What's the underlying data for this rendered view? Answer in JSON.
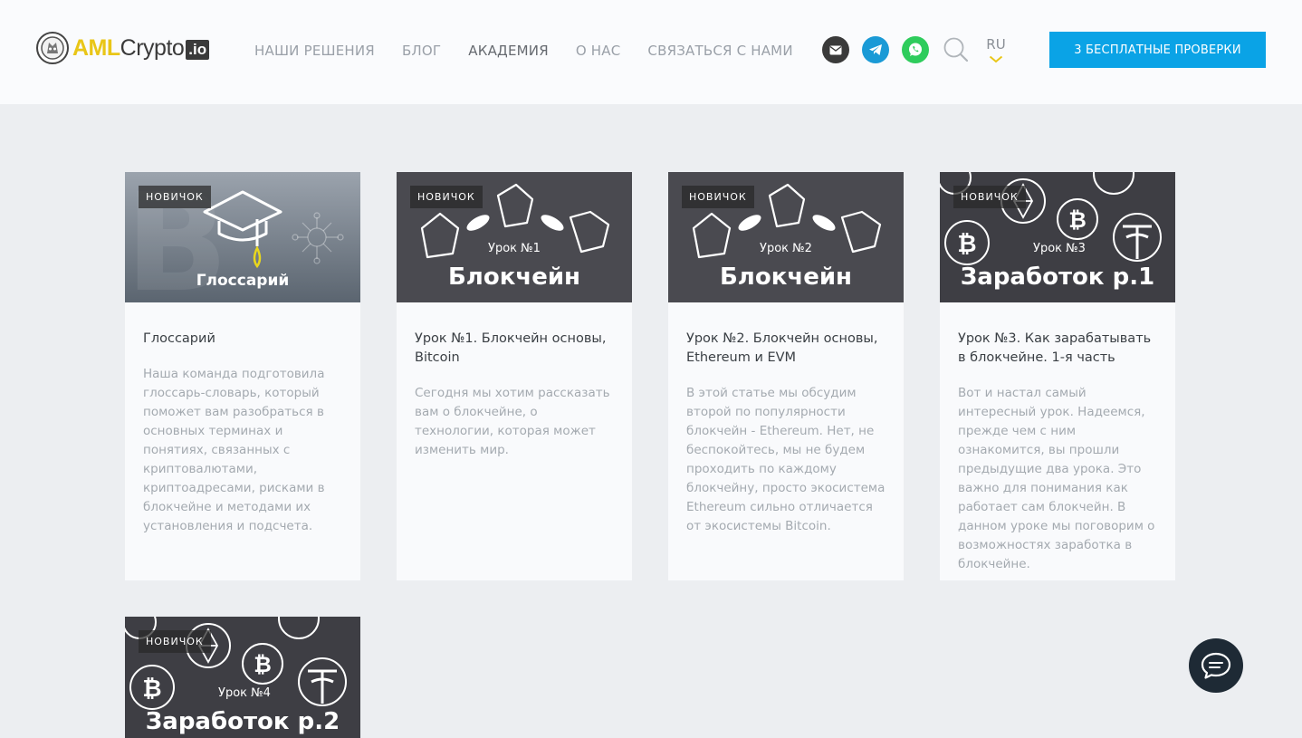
{
  "header": {
    "logo": {
      "brand_a": "AML",
      "brand_b": "Crypto",
      "brand_c": ".io"
    },
    "nav": [
      {
        "label": "НАШИ РЕШЕНИЯ"
      },
      {
        "label": "БЛОГ"
      },
      {
        "label": "АКАДЕМИЯ"
      },
      {
        "label": "О НАС"
      },
      {
        "label": "СВЯЗАТЬСЯ С НАМИ"
      }
    ],
    "social_icons": [
      "mail-icon",
      "telegram-icon",
      "whatsapp-icon"
    ],
    "language": "RU",
    "cta_label": "3 БЕСПЛАТНЫЕ ПРОВЕРКИ"
  },
  "cards": [
    {
      "badge": "НОВИЧОК",
      "image_text": "Глоссарий",
      "title": "Глоссарий",
      "description": "Наша команда подготовила глоссарь-словарь, который поможет вам разобраться в основных терминах и понятиях, связанных с криптовалютами, криптоадресами, рисками в блокчейне и методами их установления и подсчета."
    },
    {
      "badge": "НОВИЧОК",
      "image_subtitle": "Урок №1",
      "image_text": "Блокчейн",
      "title": "Урок №1. Блокчейн основы, Bitcoin",
      "description": "Сегодня мы хотим рассказать вам о блокчейне, о технологии, которая может изменить мир."
    },
    {
      "badge": "НОВИЧОК",
      "image_subtitle": "Урок №2",
      "image_text": "Блокчейн",
      "title": "Урок №2. Блокчейн основы, Ethereum и EVM",
      "description": "В этой статье мы обсудим второй по популярности блокчейн - Ethereum. Нет, не беспокойтесь, мы не будем проходить по каждому блокчейну, просто экосистема Ethereum сильно отличается от экосистемы Bitcoin."
    },
    {
      "badge": "НОВИЧОК",
      "image_subtitle": "Урок №3",
      "image_text": "Заработок р.1",
      "title": "Урок №3. Как зарабатывать в блокчейне. 1-я часть",
      "description": "Вот и настал самый интересный урок. Надеемся, прежде чем с ним ознакомится, вы прошли предыдущие два урока. Это важно для понимания как работает сам блокчейн. В данном уроке мы поговорим о возможностях заработка в блокчейне."
    },
    {
      "badge": "НОВИЧОК",
      "image_subtitle": "Урок №4",
      "image_text": "Заработок р.2"
    }
  ],
  "colors": {
    "brand_yellow": "#e9c617",
    "cta_blue": "#0aa3e6",
    "telegram": "#1a9ad6",
    "whatsapp": "#2ecc5c",
    "chat_button": "#1e2a35"
  },
  "chat_icon": "chat-bubble-icon"
}
